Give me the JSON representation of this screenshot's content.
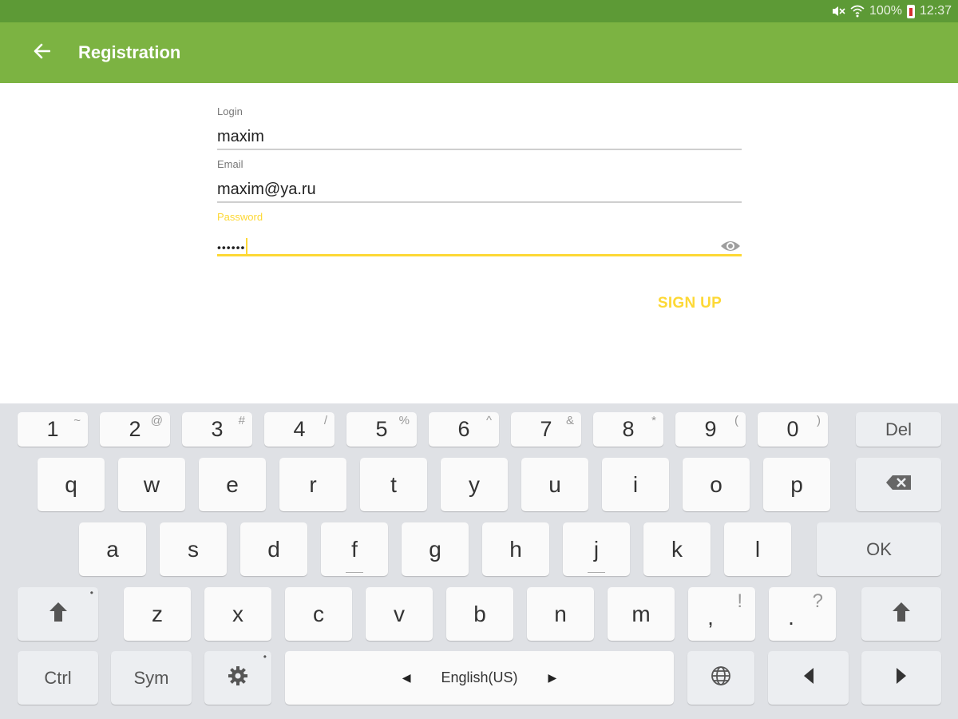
{
  "status_bar": {
    "battery": "100%",
    "time": "12:37",
    "icons": [
      "mute-icon",
      "wifi-icon",
      "battery-icon"
    ]
  },
  "app_bar": {
    "title": "Registration",
    "back_icon": "arrow-left-icon",
    "color": "#7cb342"
  },
  "form": {
    "login": {
      "label": "Login",
      "value": "maxim"
    },
    "email": {
      "label": "Email",
      "value": "maxim@ya.ru"
    },
    "password": {
      "label": "Password",
      "value": "••••••"
    },
    "signup_label": "SIGN UP",
    "accent": "#fdd835"
  },
  "keyboard": {
    "number_row": [
      {
        "main": "1",
        "hint": "~"
      },
      {
        "main": "2",
        "hint": "@"
      },
      {
        "main": "3",
        "hint": "#"
      },
      {
        "main": "4",
        "hint": "/"
      },
      {
        "main": "5",
        "hint": "%"
      },
      {
        "main": "6",
        "hint": "^"
      },
      {
        "main": "7",
        "hint": "&"
      },
      {
        "main": "8",
        "hint": "*"
      },
      {
        "main": "9",
        "hint": "("
      },
      {
        "main": "0",
        "hint": ")"
      }
    ],
    "del": "Del",
    "row1": [
      "q",
      "w",
      "e",
      "r",
      "t",
      "y",
      "u",
      "i",
      "o",
      "p"
    ],
    "row2": [
      "a",
      "s",
      "d",
      "f",
      "g",
      "h",
      "j",
      "k",
      "l"
    ],
    "ok": "OK",
    "row3": [
      "z",
      "x",
      "c",
      "v",
      "b",
      "n",
      "m"
    ],
    "comma": {
      "main": ",",
      "hint": "!"
    },
    "period": {
      "main": ".",
      "hint": "?"
    },
    "ctrl": "Ctrl",
    "sym": "Sym",
    "language": "English(US)",
    "arrow_left": "◀",
    "arrow_right": "▶"
  }
}
